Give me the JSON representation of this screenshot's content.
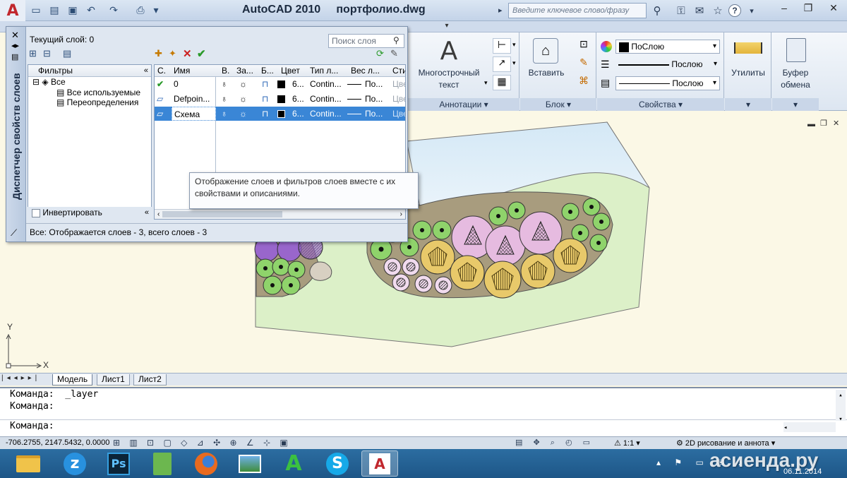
{
  "title_bar": {
    "app_name": "AutoCAD 2010",
    "file_name": "портфолио.dwg",
    "search_placeholder": "Введите ключевое слово/фразу"
  },
  "ribbon": {
    "multiline_text_label": "Многострочный\nтекст",
    "multiline_line1": "Многострочный",
    "multiline_line2": "текст",
    "annotations_panel": "Аннотации",
    "insert_label": "Вставить",
    "block_panel": "Блок",
    "color_value": "ПоСлою",
    "linetype_value": "Послою",
    "lineweight_value": "Послою",
    "properties_panel": "Свойства",
    "utilities_label": "Утилиты",
    "clipboard_line1": "Буфер",
    "clipboard_line2": "обмена"
  },
  "layer_manager": {
    "vertical_title": "Диспетчер свойств слоев",
    "current_layer": "Текущий слой: 0",
    "search_placeholder": "Поиск слоя",
    "filters_header": "Фильтры",
    "tree": {
      "all": "Все",
      "all_used": "Все используемые",
      "overrides": "Переопределения"
    },
    "invert_label": "Инвертировать",
    "columns": {
      "status": "С.",
      "name": "Имя",
      "on": "В.",
      "freeze": "За...",
      "lock": "Б...",
      "color": "Цвет",
      "linetype": "Тип л...",
      "lineweight": "Вес л...",
      "style": "Сти"
    },
    "layers": [
      {
        "name": "0",
        "color": "6...",
        "linetype": "Contin...",
        "lineweight": "По...",
        "style": "Цве"
      },
      {
        "name": "Defpoin...",
        "color": "6...",
        "linetype": "Contin...",
        "lineweight": "По...",
        "style": "Цве"
      },
      {
        "name": "Схема",
        "color": "6...",
        "linetype": "Contin...",
        "lineweight": "По...",
        "style": "Цве"
      }
    ],
    "tooltip": "Отображение слоев и фильтров слоев вместе с их свойствами и описаниями.",
    "status_text": "Все: Отображается слоев - 3, всего слоев - 3"
  },
  "ucs": {
    "y": "Y",
    "x": "X"
  },
  "sheet_tabs": [
    "Модель",
    "Лист1",
    "Лист2"
  ],
  "command_line": {
    "line1": "Команда:  _layer",
    "line2": "Команда:",
    "prompt": "Команда:"
  },
  "status_bar": {
    "coordinates": "-706.2755, 2147.5432, 0.0000",
    "scale": "1:1",
    "workspace": "2D рисование и аннота"
  },
  "taskbar": {
    "date": "06.11.2014",
    "watermark": "асиенда.ру"
  },
  "colors": {
    "plan_green": "#dcf0c8",
    "water": "#d8ecf6",
    "soil": "#a89c7e",
    "shrub_green": "#8fd36b",
    "flower_pink": "#e6bbe0",
    "bush_yellow": "#e8c96a",
    "purple": "#9966cc",
    "selection": "#3a86d6"
  }
}
